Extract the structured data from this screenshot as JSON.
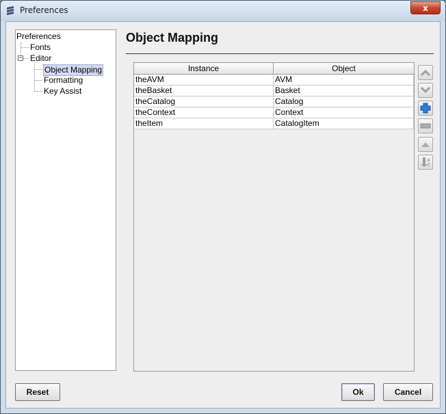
{
  "window": {
    "title": "Preferences",
    "close_label": "x"
  },
  "tree": {
    "root": "Preferences",
    "items": [
      {
        "label": "Fonts"
      },
      {
        "label": "Editor",
        "expander": "−"
      },
      {
        "label": "Object Mapping",
        "selected": true
      },
      {
        "label": "Formatting"
      },
      {
        "label": "Key Assist"
      }
    ]
  },
  "content": {
    "title": "Object Mapping",
    "table": {
      "columns": [
        "Instance",
        "Object"
      ],
      "rows": [
        [
          "theAVM",
          "AVM"
        ],
        [
          "theBasket",
          "Basket"
        ],
        [
          "theCatalog",
          "Catalog"
        ],
        [
          "theContext",
          "Context"
        ],
        [
          "theItem",
          "CatalogItem"
        ]
      ]
    },
    "side_buttons": [
      "move-up-icon",
      "move-down-icon",
      "add-icon",
      "remove-icon",
      "sort-ascending-icon",
      "sort-descending-icon"
    ]
  },
  "buttons": {
    "reset": "Reset",
    "ok": "Ok",
    "cancel": "Cancel"
  },
  "colors": {
    "selection": "#d4d8f0",
    "add_icon": "#1e6fd0",
    "close_button": "#c9462f"
  }
}
